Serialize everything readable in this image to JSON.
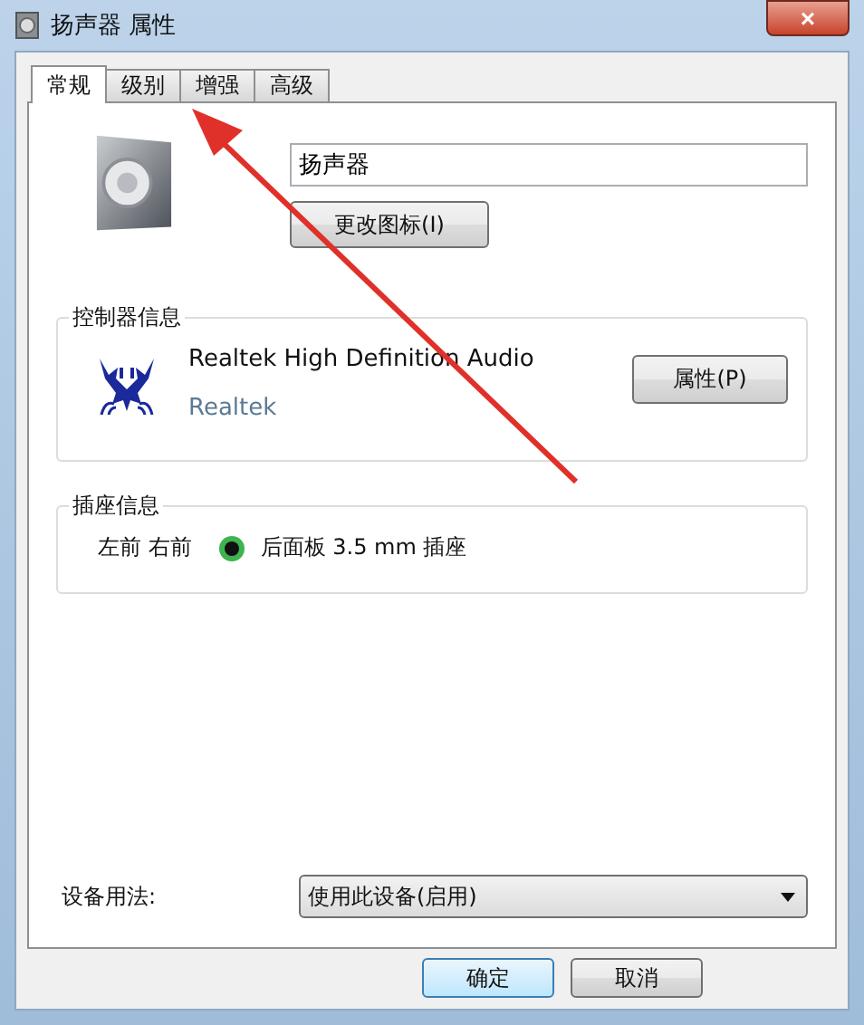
{
  "window": {
    "title": "扬声器 属性",
    "close": "×"
  },
  "tabs": [
    {
      "label": "常规",
      "selected": true
    },
    {
      "label": "级别",
      "selected": false
    },
    {
      "label": "增强",
      "selected": false
    },
    {
      "label": "高级",
      "selected": false
    }
  ],
  "device": {
    "name_value": "扬声器",
    "change_icon_button": "更改图标(I)"
  },
  "controller": {
    "legend": "控制器信息",
    "name": "Realtek High Definition Audio",
    "vendor": "Realtek",
    "properties_button": "属性(P)"
  },
  "jack": {
    "legend": "插座信息",
    "channels": "左前 右前",
    "description": "后面板 3.5 mm 插座"
  },
  "usage": {
    "label": "设备用法:",
    "value": "使用此设备(启用)"
  },
  "buttons": [
    "确定",
    "取消"
  ]
}
